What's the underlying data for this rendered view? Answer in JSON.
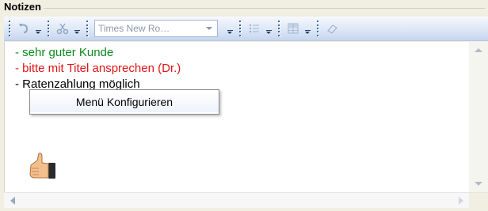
{
  "group": {
    "title": "Notizen"
  },
  "toolbar": {
    "font_name": "Times New Ro…",
    "buttons": [
      {
        "icon": "undo-icon"
      },
      {
        "icon": "cut-icon"
      },
      {
        "icon": "font-dropdown"
      },
      {
        "icon": "list-icon"
      },
      {
        "icon": "table-icon"
      },
      {
        "icon": "eraser-icon"
      }
    ]
  },
  "editor": {
    "lines": [
      {
        "text": "- sehr guter Kunde",
        "color": "#0c8a1c"
      },
      {
        "text": "- bitte mit Titel ansprechen (Dr.)",
        "color": "#e01515"
      },
      {
        "text": "- Ratenzahlung möglich",
        "color": "#000000"
      }
    ],
    "image_icon": "thumbs-up-icon"
  },
  "context_menu": {
    "items": [
      "Menü Konfigurieren"
    ]
  }
}
